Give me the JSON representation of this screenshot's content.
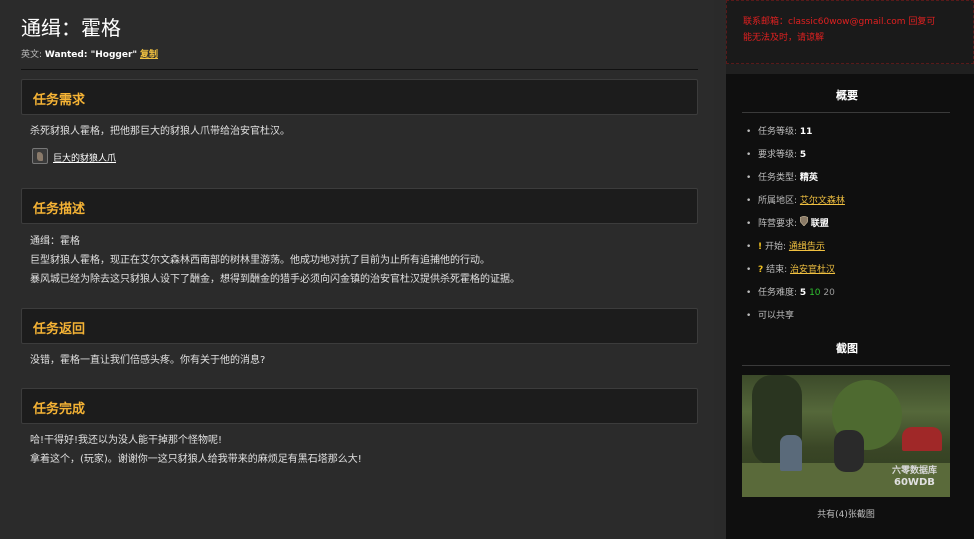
{
  "quest": {
    "title": "通缉：霍格",
    "en_prefix": "英文:",
    "en_name": "Wanted: \"Hogger\"",
    "copy_label": "复制"
  },
  "sections": {
    "requirements": {
      "heading": "任务需求",
      "text": "杀死豺狼人霍格，把他那巨大的豺狼人爪带给治安官杜汉。",
      "item_icon": "claw-icon",
      "item_label": "巨大的豺狼人爪"
    },
    "description": {
      "heading": "任务描述",
      "lines": [
        "通缉：霍格",
        "巨型豺狼人霍格，现正在艾尔文森林西南部的树林里游荡。他成功地对抗了目前为止所有追捕他的行动。",
        "暴风城已经为除去这只豺狼人设下了酬金，想得到酬金的猎手必须向闪金镇的治安官杜汉提供杀死霍格的证据。"
      ]
    },
    "return": {
      "heading": "任务返回",
      "text": "没错，霍格一直让我们倍感头疼。你有关于他的消息?"
    },
    "complete": {
      "heading": "任务完成",
      "lines": [
        "哈!干得好!我还以为没人能干掉那个怪物呢!",
        "拿着这个，(玩家)。谢谢你一这只豺狼人给我带来的麻烦足有黑石塔那么大!"
      ]
    }
  },
  "sidebar": {
    "contact_line1": "联系邮箱：classic60wow@gmail.com 回复可",
    "contact_line2": "能无法及时，请谅解",
    "summary_title": "概要",
    "quest_level_label": "任务等级:",
    "quest_level": "11",
    "req_level_label": "要求等级:",
    "req_level": "5",
    "quest_type_label": "任务类型:",
    "quest_type": "精英",
    "zone_label": "所属地区:",
    "zone": "艾尔文森林",
    "faction_label": "阵营要求:",
    "faction": "联盟",
    "faction_icon": "shield-icon",
    "start_label": "开始:",
    "start_npc": "通缉告示",
    "start_icon": "exclamation-icon",
    "end_label": "结束:",
    "end_npc": "治安官杜汉",
    "end_icon": "question-icon",
    "difficulty_label": "任务难度:",
    "difficulty": [
      "5",
      "10",
      "20"
    ],
    "shareable": "可以共享",
    "screenshots_title": "截图",
    "watermark_cn": "六零数据库",
    "watermark_en": "60WDB",
    "screenshots_caption": "共有(4)张截图"
  },
  "colors": {
    "heading": "#f5b335",
    "link": "#f0c040",
    "contact": "#e02020",
    "difficulty_green": "#30c030"
  }
}
